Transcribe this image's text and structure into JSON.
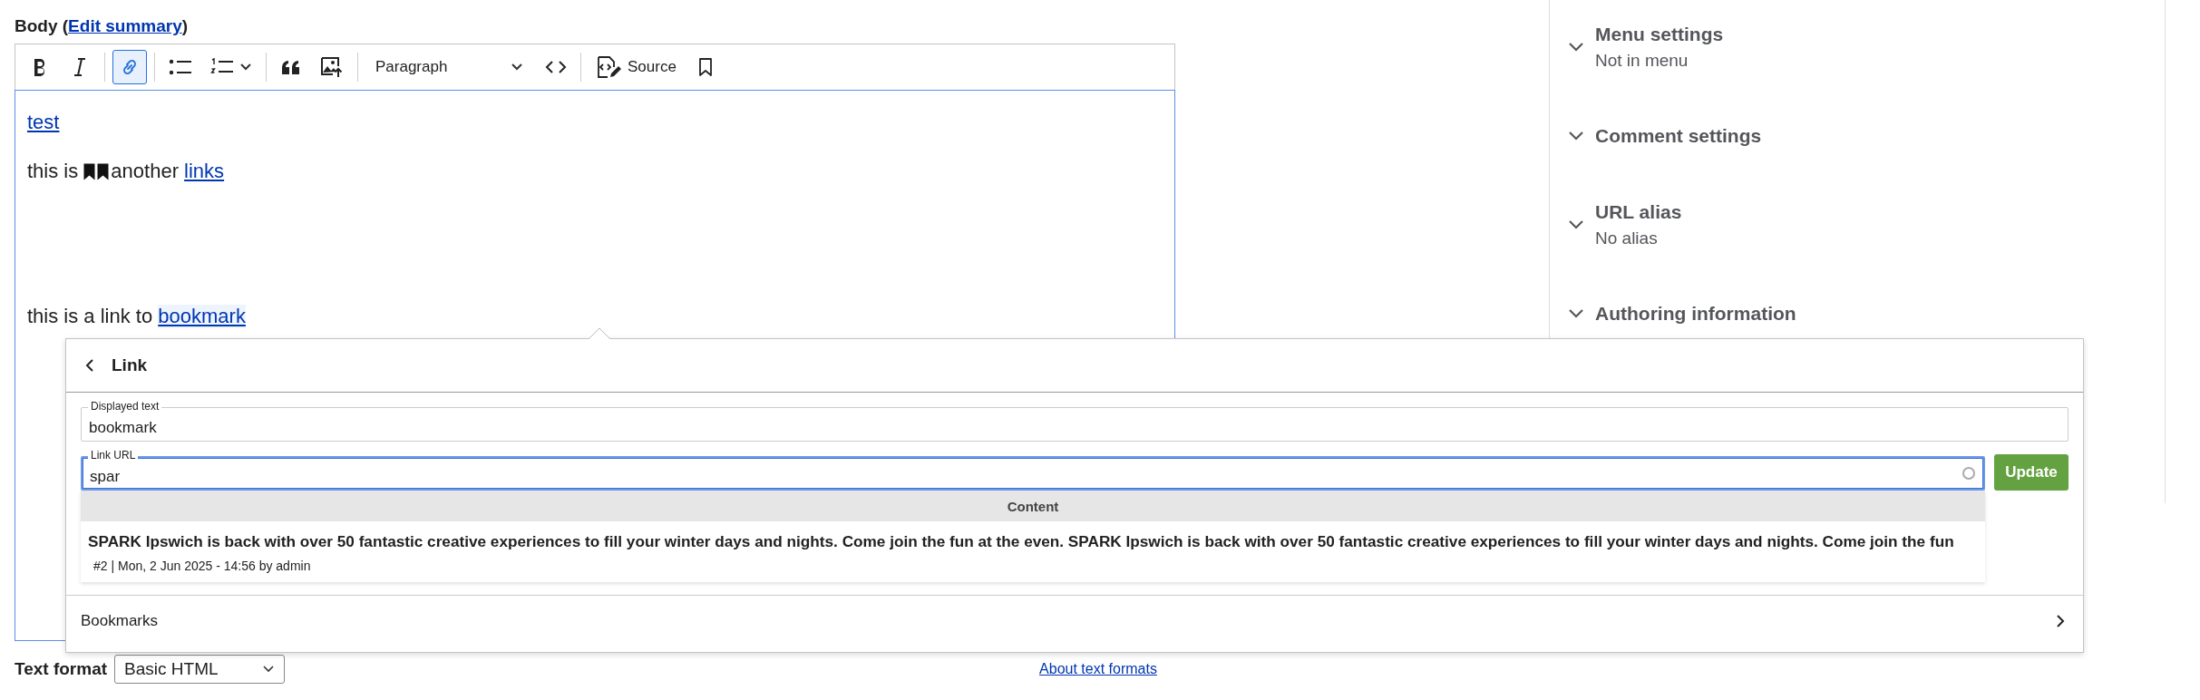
{
  "field_label": {
    "prefix": "Body (",
    "link": "Edit summary",
    "suffix": ")"
  },
  "toolbar": [
    {
      "kind": "bold",
      "selected": false
    },
    {
      "kind": "italic",
      "selected": false
    },
    {
      "kind": "separator"
    },
    {
      "kind": "link",
      "selected": true
    },
    {
      "kind": "separator"
    },
    {
      "kind": "bulleted",
      "selected": false
    },
    {
      "kind": "numbered",
      "selected": false
    },
    {
      "kind": "separator"
    },
    {
      "kind": "quote",
      "selected": false
    },
    {
      "kind": "image",
      "selected": false
    },
    {
      "kind": "separator"
    },
    {
      "kind": "heading",
      "label": "Paragraph"
    },
    {
      "kind": "code",
      "selected": false
    },
    {
      "kind": "separator"
    },
    {
      "kind": "source",
      "label": "Source",
      "selected": false
    },
    {
      "kind": "bookmark",
      "selected": false
    }
  ],
  "content": [
    {
      "segments": [
        {
          "kind": "link",
          "text": "test",
          "selected": false
        }
      ]
    },
    {
      "segments": [
        {
          "kind": "text",
          "text": "this is "
        },
        {
          "kind": "bookmark"
        },
        {
          "kind": "bookmark"
        },
        {
          "kind": "text",
          "text": "another "
        },
        {
          "kind": "link",
          "text": "links",
          "selected": false
        }
      ]
    },
    {
      "segments": [
        {
          "kind": "text",
          "text": "this is a link to "
        },
        {
          "kind": "link",
          "text": "bookmark",
          "selected": true
        }
      ]
    }
  ],
  "sidebar": [
    {
      "title": "Menu settings",
      "summary": "Not in menu"
    },
    {
      "title": "Comment settings"
    },
    {
      "title": "URL alias",
      "summary": "No alias"
    },
    {
      "title": "Authoring information"
    }
  ],
  "link_popup": {
    "title": "Link",
    "fields": [
      {
        "label": "Displayed text",
        "value": "bookmark",
        "focused": false
      },
      {
        "label": "Link URL",
        "value": "spar",
        "focused": true
      }
    ],
    "button": "Update",
    "autocomplete": {
      "group": "Content",
      "results": [
        {
          "title": "SPARK Ipswich is back with over 50 fantastic creative experiences to fill your winter days and nights. Come join the fun at the even. SPARK Ipswich is back with over 50 fantastic creative experiences to fill your winter days and nights. Come join the fun",
          "meta": "#2 | Mon, 2 Jun 2025 - 14:56 by admin"
        }
      ]
    },
    "bookmarks": "Bookmarks"
  },
  "text_format": {
    "label": "Text format",
    "value": "Basic HTML",
    "help_link": "About text formats"
  }
}
